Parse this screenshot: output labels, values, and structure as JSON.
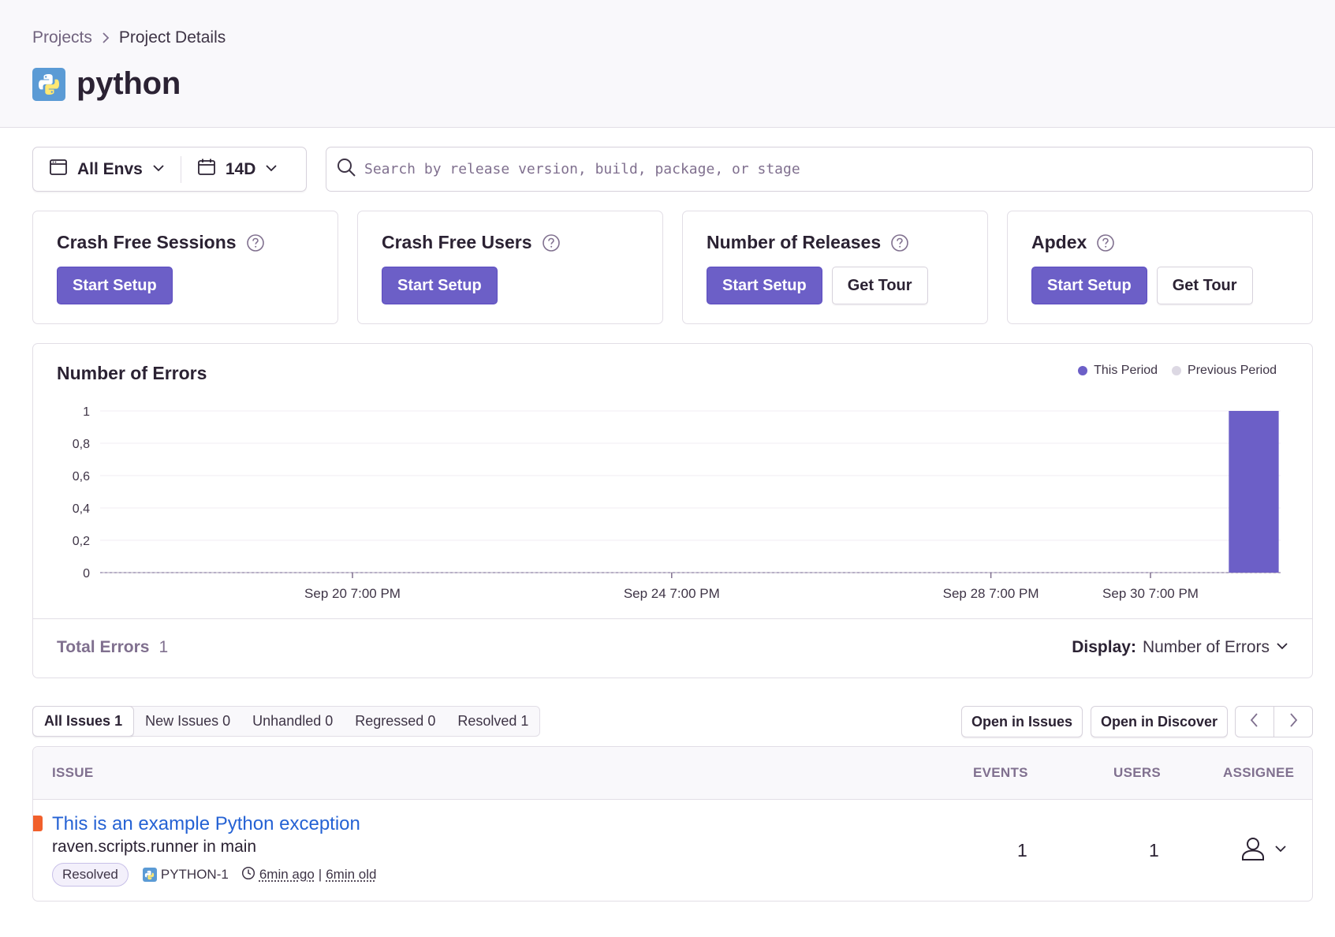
{
  "breadcrumb": {
    "parent": "Projects",
    "current": "Project Details"
  },
  "project": {
    "name": "python",
    "icon": "python-logo"
  },
  "filters": {
    "environment": "All Envs",
    "period": "14D",
    "search_placeholder": "Search by release version, build, package, or stage"
  },
  "score_cards": [
    {
      "title": "Crash Free Sessions",
      "primary": "Start Setup"
    },
    {
      "title": "Crash Free Users",
      "primary": "Start Setup"
    },
    {
      "title": "Number of Releases",
      "primary": "Start Setup",
      "secondary": "Get Tour"
    },
    {
      "title": "Apdex",
      "primary": "Start Setup",
      "secondary": "Get Tour"
    }
  ],
  "chart": {
    "title": "Number of Errors",
    "legend": {
      "this_period": "This Period",
      "previous_period": "Previous Period"
    },
    "total_label": "Total Errors",
    "total_value": "1",
    "display_label": "Display:",
    "display_value": "Number of Errors"
  },
  "chart_data": {
    "type": "bar",
    "title": "Number of Errors",
    "y_ticks": [
      "0",
      "0,2",
      "0,4",
      "0,6",
      "0,8",
      "1"
    ],
    "ylim": [
      0,
      1
    ],
    "x_ticks": [
      "Sep 20 7:00 PM",
      "Sep 24 7:00 PM",
      "Sep 28 7:00 PM",
      "Sep 30 7:00 PM"
    ],
    "grid": true,
    "legend_position": "top-right",
    "series": [
      {
        "name": "This Period",
        "color": "#6c5fc7",
        "values": [
          0,
          0,
          0,
          0,
          0,
          0,
          0,
          0,
          0,
          0,
          0,
          0,
          0,
          0,
          0,
          0,
          0,
          0,
          0,
          0,
          0,
          1
        ]
      },
      {
        "name": "Previous Period",
        "color": "#dcd8e3",
        "values": [
          0,
          0,
          0,
          0,
          0,
          0,
          0,
          0,
          0,
          0,
          0,
          0,
          0,
          0,
          0,
          0,
          0,
          0,
          0,
          0,
          0,
          0
        ]
      }
    ]
  },
  "issues": {
    "tabs": [
      {
        "label": "All Issues",
        "count": "1",
        "active": true
      },
      {
        "label": "New Issues",
        "count": "0"
      },
      {
        "label": "Unhandled",
        "count": "0"
      },
      {
        "label": "Regressed",
        "count": "0"
      },
      {
        "label": "Resolved",
        "count": "1"
      }
    ],
    "actions": {
      "open_issues": "Open in Issues",
      "open_discover": "Open in Discover"
    },
    "columns": {
      "issue": "ISSUE",
      "events": "EVENTS",
      "users": "USERS",
      "assignee": "ASSIGNEE"
    },
    "rows": [
      {
        "title": "This is an example Python exception",
        "culprit": "raven.scripts.runner in main",
        "status": "Resolved",
        "short_id": "PYTHON-1",
        "last_seen": "6min ago",
        "first_seen": "6min old",
        "events": "1",
        "users": "1"
      }
    ]
  },
  "colors": {
    "accent": "#6c5fc7",
    "link": "#2562d4",
    "level_error": "#f1602c"
  }
}
